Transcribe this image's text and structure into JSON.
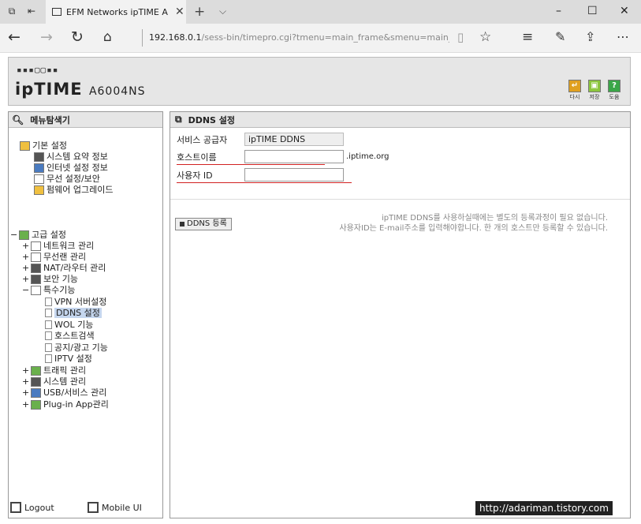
{
  "browser": {
    "tab_title": "EFM Networks ipTIME A",
    "address_host": "192.168.0.1",
    "address_path": "/sess-bin/timepro.cgi?tmenu=main_frame&smenu=main_fran"
  },
  "header": {
    "logo_dots": "▪▪▪▢▢▪▪",
    "brand": "ipTIME",
    "model": "A6004NS",
    "buttons": [
      {
        "label": "다시",
        "color": "#e0a020"
      },
      {
        "label": "저장",
        "color": "#8cc63e"
      },
      {
        "label": "도움",
        "color": "#3aa648"
      }
    ]
  },
  "menu": {
    "title": "메뉴탐색기",
    "basic_group": "기본 설정",
    "basic_items": [
      "시스템 요약 정보",
      "인터넷 설정 정보",
      "무선 설정/보안",
      "펌웨어 업그레이드"
    ],
    "advanced_group": "고급 설정",
    "advanced_items": [
      "네트워크 관리",
      "무선랜 관리",
      "NAT/라우터 관리",
      "보안 기능",
      "특수기능"
    ],
    "special_items": [
      "VPN 서버설정",
      "DDNS 설정",
      "WOL 기능",
      "호스트검색",
      "공지/광고 기능",
      "IPTV 설정"
    ],
    "bottom_items": [
      "트래픽 관리",
      "시스템 관리",
      "USB/서비스 관리",
      "Plug-in App관리"
    ],
    "footer": {
      "logout": "Logout",
      "mobile": "Mobile UI"
    }
  },
  "panel": {
    "title": "DDNS 설정",
    "provider_label": "서비스 공급자",
    "provider_value": "ipTIME DDNS",
    "host_label": "호스트이름",
    "host_value": "",
    "host_suffix": ".iptime.org",
    "user_label": "사용자 ID",
    "user_value": "",
    "register_button": "DDNS 등록",
    "note_line1": "ipTIME DDNS를 사용하실때에는 별도의 등록과정이 필요 없습니다.",
    "note_line2": "사용자ID는 E-mail주소를 입력해야합니다. 한 개의 호스트만 등록할 수 있습니다."
  },
  "watermark": "http://adariman.tistory.com",
  "colors": {
    "underline": "#d22222",
    "selected": "#c5d6ee"
  }
}
